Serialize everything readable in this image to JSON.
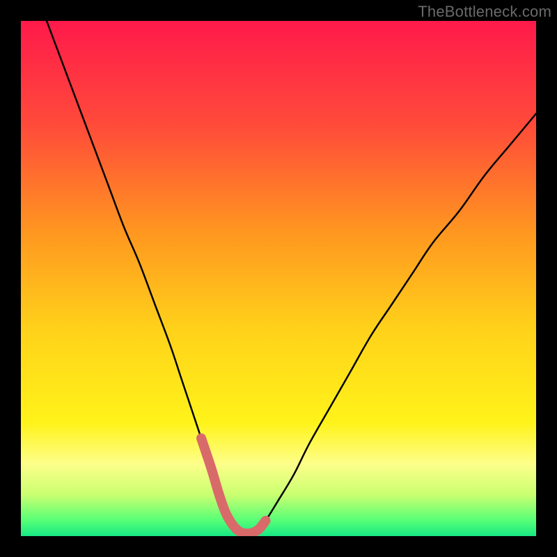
{
  "watermark": "TheBottleneck.com",
  "chart_data": {
    "type": "line",
    "title": "",
    "xlabel": "",
    "ylabel": "",
    "xlim": [
      0,
      100
    ],
    "ylim": [
      0,
      100
    ],
    "grid": false,
    "legend": false,
    "background_gradient": {
      "stops": [
        {
          "offset": 0.0,
          "color": "#ff1a4b"
        },
        {
          "offset": 0.2,
          "color": "#ff4a3a"
        },
        {
          "offset": 0.42,
          "color": "#ff9a1f"
        },
        {
          "offset": 0.6,
          "color": "#ffd21a"
        },
        {
          "offset": 0.78,
          "color": "#fff31a"
        },
        {
          "offset": 0.86,
          "color": "#fdff8a"
        },
        {
          "offset": 0.92,
          "color": "#c9ff70"
        },
        {
          "offset": 0.97,
          "color": "#55ff77"
        },
        {
          "offset": 1.0,
          "color": "#18e884"
        }
      ]
    },
    "series": [
      {
        "name": "bottleneck-curve",
        "color": "#000000",
        "stroke_width": 2.5,
        "x": [
          5,
          8,
          11,
          14,
          17,
          20,
          23,
          26,
          29,
          31,
          33,
          35,
          37,
          38.5,
          40,
          42,
          44,
          46,
          47.5,
          50,
          53,
          56,
          60,
          64,
          68,
          72,
          76,
          80,
          85,
          90,
          95,
          100
        ],
        "y": [
          100,
          92,
          84,
          76,
          68,
          60,
          53,
          45,
          37,
          31,
          25,
          19,
          13,
          8,
          4,
          1.2,
          0.5,
          1.2,
          3,
          7,
          12,
          18,
          25,
          32,
          39,
          45,
          51,
          57,
          63,
          70,
          76,
          82
        ]
      },
      {
        "name": "highlight-salmon",
        "color": "#d96a6a",
        "stroke_width": 14,
        "linecap": "round",
        "x": [
          35,
          37,
          38.5,
          40,
          42,
          44,
          46,
          47.5
        ],
        "y": [
          19,
          13,
          8,
          4,
          1.2,
          0.5,
          1.2,
          3
        ]
      }
    ]
  }
}
